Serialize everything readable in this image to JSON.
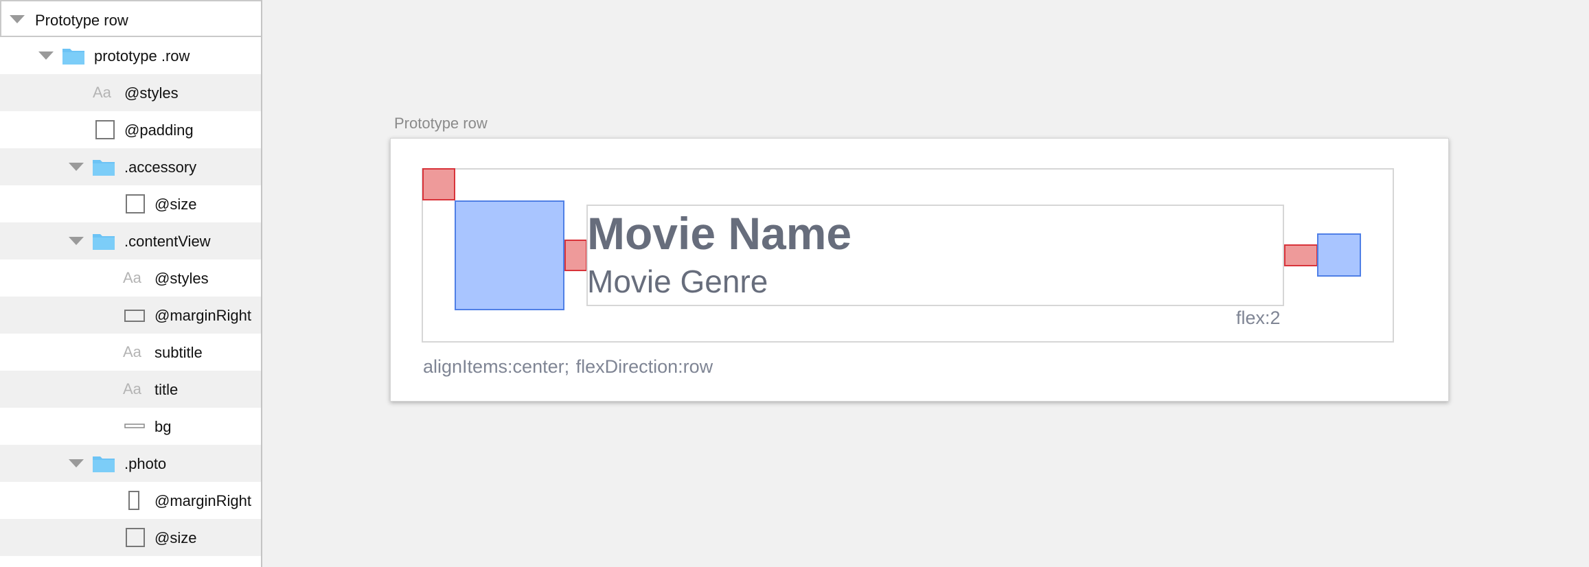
{
  "sidebar": {
    "header_label": "Prototype row",
    "items": [
      {
        "label": "prototype .row",
        "icon": "folder-icon",
        "expanded": true
      },
      {
        "label": "@styles",
        "icon": "text-style-icon"
      },
      {
        "label": "@padding",
        "icon": "square-outline-icon"
      },
      {
        "label": ".accessory",
        "icon": "folder-icon",
        "expanded": true
      },
      {
        "label": "@size",
        "icon": "square-outline-icon"
      },
      {
        "label": ".contentView",
        "icon": "folder-icon",
        "expanded": true
      },
      {
        "label": "@styles",
        "icon": "text-style-icon"
      },
      {
        "label": "@marginRight",
        "icon": "wide-rect-outline-icon"
      },
      {
        "label": "subtitle",
        "icon": "text-style-icon"
      },
      {
        "label": "title",
        "icon": "text-style-icon"
      },
      {
        "label": "bg",
        "icon": "thin-bar-icon"
      },
      {
        "label": ".photo",
        "icon": "folder-icon",
        "expanded": true
      },
      {
        "label": "@marginRight",
        "icon": "tall-rect-outline-icon"
      },
      {
        "label": "@size",
        "icon": "square-outline-icon"
      }
    ],
    "aa_glyph": "Aa"
  },
  "canvas": {
    "caption": "Prototype row",
    "title_text": "Movie Name",
    "genre_text": "Movie Genre",
    "flex_label": "flex:2",
    "style_caption": "alignItems:center;  flexDirection:row"
  },
  "colors": {
    "folder": "#6cc3f5",
    "red_fill": "#ee9a9a",
    "red_border": "#d8333a",
    "blue_fill": "#a9c5ff",
    "blue_border": "#4f7fe6",
    "text_gray": "#676d7c"
  }
}
